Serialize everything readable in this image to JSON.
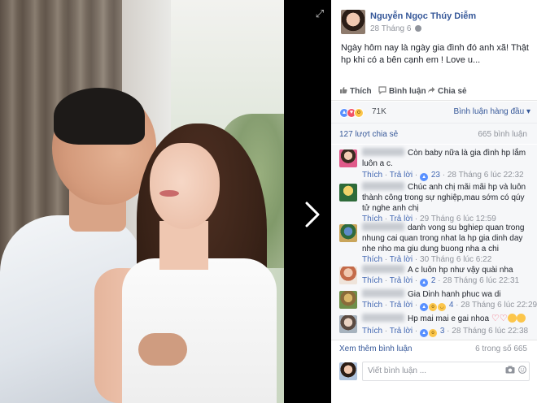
{
  "viewer": {
    "expand_icon": "expand-icon",
    "next_icon": "chevron-right-icon"
  },
  "post": {
    "author": "Nguyễn Ngọc Thúy Diễm",
    "time": "28 Tháng 6",
    "text": "Ngày hôm nay là ngày gia đình đó anh xã! Thật hp khi có a bên cạnh em ! Love u..."
  },
  "actions": {
    "like": "Thích",
    "comment": "Bình luận",
    "share": "Chia sẻ"
  },
  "reactions": {
    "count": "71K",
    "sort_label": "Bình luận hàng đầu"
  },
  "stats": {
    "shares": "127 lượt chia sẻ",
    "comments": "665 bình luận"
  },
  "comments": [
    {
      "text": "Còn baby nữa là gia đình hp lắm luôn a c.",
      "like": "Thích",
      "reply": "Trả lời",
      "reaction_count": "23",
      "time": "28 Tháng 6 lúc 22:32"
    },
    {
      "text": "Chúc anh chị mãi mãi hp và luôn thành công trong sự nghiệp,mau sớm có qúy tử nghe anh chị",
      "like": "Thích",
      "reply": "Trả lời",
      "reaction_count": "",
      "time": "29 Tháng 6 lúc 12:59"
    },
    {
      "text": "danh vong su bghiep quan trong nhung cai quan trong nhat la hp gia dinh day nhe nho ma giu dung buong nha a chi",
      "like": "Thích",
      "reply": "Trả lời",
      "reaction_count": "",
      "time": "30 Tháng 6 lúc 6:22"
    },
    {
      "text": "A c luôn hp như vậy quài nha",
      "like": "Thích",
      "reply": "Trả lời",
      "reaction_count": "2",
      "time": "28 Tháng 6 lúc 22:31"
    },
    {
      "text": "Gia Dinh hanh phuc wa di",
      "like": "Thích",
      "reply": "Trả lời",
      "reaction_count": "4",
      "time": "28 Tháng 6 lúc 22:29"
    },
    {
      "text": "Hp mai mai e gai nhoa",
      "like": "Thích",
      "reply": "Trả lời",
      "reaction_count": "3",
      "time": "28 Tháng 6 lúc 22:38"
    }
  ],
  "more": {
    "link": "Xem thêm bình luận",
    "count": "6 trong số 665"
  },
  "composer": {
    "placeholder": "Viết bình luận ..."
  },
  "colors": {
    "link_blue": "#365899",
    "like_blue": "#5890ff",
    "love_red": "#f25268",
    "wow_yellow": "#fcc64b",
    "panel_bg": "#f6f7f9"
  }
}
